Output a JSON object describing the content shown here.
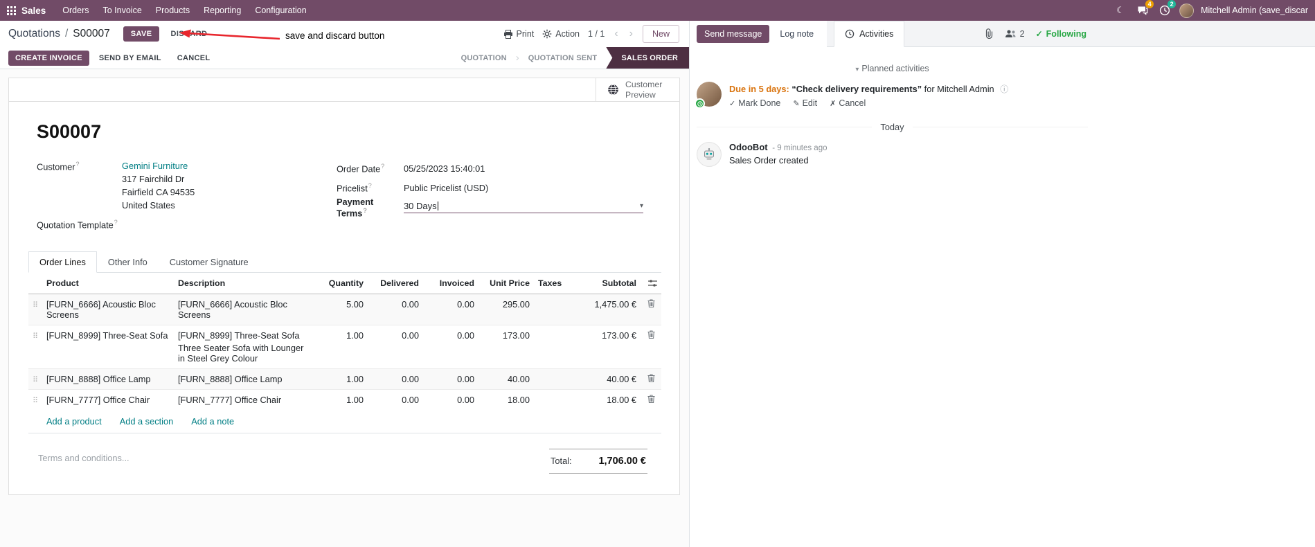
{
  "colors": {
    "brand_purple": "#714B67",
    "active_state_bg": "#4d2f42",
    "link_teal": "#017e84",
    "changed_value_blue": "#2477b3",
    "due_warning_orange": "#d9730d",
    "following_green": "#28a745",
    "annotation_red": "#e8262d",
    "badge_orange": "#eda002",
    "badge_green": "#21b799"
  },
  "icons": {
    "moon": "☾",
    "caret_down": "▾",
    "chevron_left": "‹",
    "chevron_right": "›",
    "step_separator": "›",
    "drag_handle": "⠿",
    "check": "✓",
    "pencil": "✎",
    "cross": "✗",
    "info": "ⓘ"
  },
  "topbar": {
    "brand": "Sales",
    "menus": [
      "Orders",
      "To Invoice",
      "Products",
      "Reporting",
      "Configuration"
    ],
    "messages_badge": "4",
    "activities_badge": "2",
    "user_name": "Mitchell Admin (save_discar"
  },
  "control_panel": {
    "breadcrumb_parent": "Quotations",
    "breadcrumb_sep": "/",
    "breadcrumb_current": "S00007",
    "save_label": "SAVE",
    "discard_label": "DISCARD",
    "print_label": "Print",
    "action_label": "Action",
    "pager": "1 / 1",
    "new_label": "New"
  },
  "annotation": {
    "text": "save and discard button"
  },
  "statusbar": {
    "create_invoice": "CREATE INVOICE",
    "send_by_email": "SEND BY EMAIL",
    "cancel": "CANCEL",
    "states": [
      "QUOTATION",
      "QUOTATION SENT",
      "SALES ORDER"
    ],
    "active_state": "SALES ORDER"
  },
  "sheet": {
    "customer_preview": "Customer Preview",
    "record_name": "S00007",
    "help_marker": "?",
    "customer": {
      "label": "Customer",
      "name": "Gemini Furniture",
      "address1": "317 Fairchild Dr",
      "address2": "Fairfield CA 94535",
      "address3": "United States"
    },
    "quotation_template_label": "Quotation Template",
    "order_date": {
      "label": "Order Date",
      "value": "05/25/2023 15:40:01"
    },
    "pricelist": {
      "label": "Pricelist",
      "value": "Public Pricelist (USD)"
    },
    "payment_terms": {
      "label": "Payment Terms",
      "value": "30 Days"
    },
    "tabs": [
      "Order Lines",
      "Other Info",
      "Customer Signature"
    ],
    "order_lines": {
      "headers": [
        "Product",
        "Description",
        "Quantity",
        "Delivered",
        "Invoiced",
        "Unit Price",
        "Taxes",
        "Subtotal"
      ],
      "rows": [
        {
          "product": "[FURN_6666] Acoustic Bloc Screens",
          "description": "[FURN_6666] Acoustic Bloc Screens",
          "description2": "",
          "quantity": "5.00",
          "delivered": "0.00",
          "invoiced": "0.00",
          "unit_price": "295.00",
          "taxes": "",
          "subtotal": "1,475.00 €"
        },
        {
          "product": "[FURN_8999] Three-Seat Sofa",
          "description": "[FURN_8999] Three-Seat Sofa",
          "description2": "Three Seater Sofa with Lounger in Steel Grey Colour",
          "quantity": "1.00",
          "delivered": "0.00",
          "invoiced": "0.00",
          "unit_price": "173.00",
          "taxes": "",
          "subtotal": "173.00 €"
        },
        {
          "product": "[FURN_8888] Office Lamp",
          "description": "[FURN_8888] Office Lamp",
          "description2": "",
          "quantity": "1.00",
          "delivered": "0.00",
          "invoiced": "0.00",
          "unit_price": "40.00",
          "taxes": "",
          "subtotal": "40.00 €"
        },
        {
          "product": "[FURN_7777] Office Chair",
          "description": "[FURN_7777] Office Chair",
          "description2": "",
          "quantity": "1.00",
          "delivered": "0.00",
          "invoiced": "0.00",
          "unit_price": "18.00",
          "taxes": "",
          "subtotal": "18.00 €"
        }
      ],
      "add_product": "Add a product",
      "add_section": "Add a section",
      "add_note": "Add a note"
    },
    "terms_placeholder": "Terms and conditions...",
    "total_label": "Total:",
    "total_value": "1,706.00 €"
  },
  "chatter": {
    "send_message": "Send message",
    "log_note": "Log note",
    "activities_tab": "Activities",
    "followers_count": "2",
    "following": "Following",
    "planned_activities_title": "Planned activities",
    "activity": {
      "due": "Due in 5 days:",
      "summary": "“Check delivery requirements”",
      "assignee": "for Mitchell Admin",
      "mark_done": "Mark Done",
      "edit": "Edit",
      "cancel": "Cancel"
    },
    "date_divider": "Today",
    "message": {
      "author": "OdooBot",
      "timestamp": "- 9 minutes ago",
      "body": "Sales Order created"
    }
  }
}
